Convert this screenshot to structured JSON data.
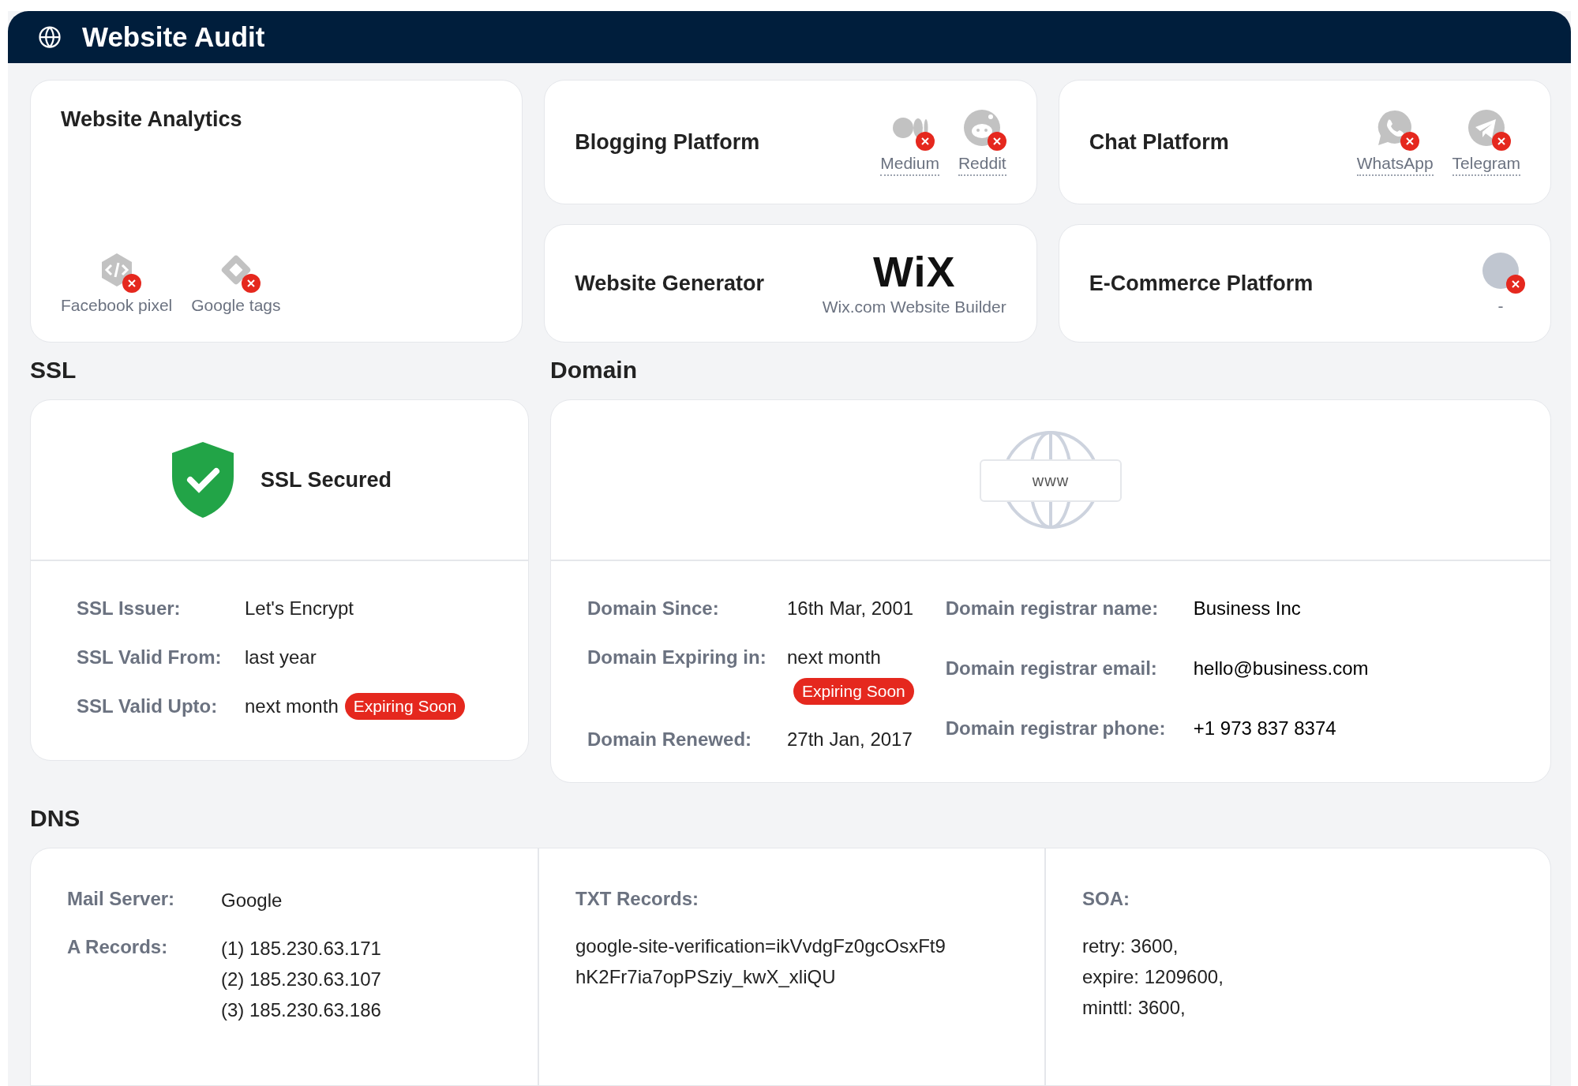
{
  "header": {
    "title": "Website Audit"
  },
  "analytics": {
    "title": "Website Analytics",
    "tools": [
      {
        "label": "Facebook pixel",
        "kind": "code",
        "detected": false
      },
      {
        "label": "Google tags",
        "kind": "tag",
        "detected": false
      }
    ]
  },
  "blogging": {
    "title": "Blogging Platform",
    "tools": [
      {
        "label": "Medium",
        "kind": "medium",
        "detected": false
      },
      {
        "label": "Reddit",
        "kind": "reddit",
        "detected": false
      }
    ]
  },
  "chat": {
    "title": "Chat Platform",
    "tools": [
      {
        "label": "WhatsApp",
        "kind": "whatsapp",
        "detected": false
      },
      {
        "label": "Telegram",
        "kind": "telegram",
        "detected": false
      }
    ]
  },
  "generator": {
    "title": "Website Generator",
    "logo": "WiX",
    "name": "Wix.com Website Builder"
  },
  "ecommerce": {
    "title": "E-Commerce Platform",
    "tools": [
      {
        "label": "-",
        "kind": "generic",
        "detected": false
      }
    ]
  },
  "ssl": {
    "heading": "SSL",
    "status": "SSL Secured",
    "secured": true,
    "fields": [
      {
        "label": "SSL Issuer:",
        "value": "Let's Encrypt"
      },
      {
        "label": "SSL Valid From:",
        "value": "last year"
      },
      {
        "label": "SSL Valid Upto:",
        "value": "next month",
        "badge": "Expiring Soon"
      }
    ]
  },
  "domain": {
    "heading": "Domain",
    "globe_text": "www",
    "fields": [
      {
        "label": "Domain Since:",
        "value": "16th Mar, 2001"
      },
      {
        "label": "Domain Expiring in:",
        "value": "next month",
        "badge": "Expiring Soon"
      },
      {
        "label": "Domain Renewed:",
        "value": "27th Jan, 2017"
      }
    ],
    "registrar": [
      {
        "label": "Domain registrar name:",
        "value": "Business Inc"
      },
      {
        "label": "Domain registrar email:",
        "value": "hello@business.com"
      },
      {
        "label": "Domain registrar phone:",
        "value": "+1 973 837 8374"
      }
    ]
  },
  "dns": {
    "heading": "DNS",
    "columns": [
      {
        "kind": "inline",
        "items": [
          {
            "label": "Mail Server:",
            "lines": [
              "Google"
            ]
          },
          {
            "label": "A Records:",
            "lines": [
              "(1) 185.230.63.171",
              "(2) 185.230.63.107",
              "(3) 185.230.63.186"
            ]
          }
        ]
      },
      {
        "kind": "stacked",
        "items": [
          {
            "label": "TXT Records:",
            "lines": [
              "google-site-verification=ikVvdgFz0gcOsxFt9",
              "hK2Fr7ia7opPSziy_kwX_xliQU"
            ]
          }
        ]
      },
      {
        "kind": "stacked",
        "items": [
          {
            "label": "SOA:",
            "lines": [
              "retry: 3600,",
              "expire: 1209600,",
              "minttl: 3600,"
            ]
          }
        ]
      }
    ]
  }
}
